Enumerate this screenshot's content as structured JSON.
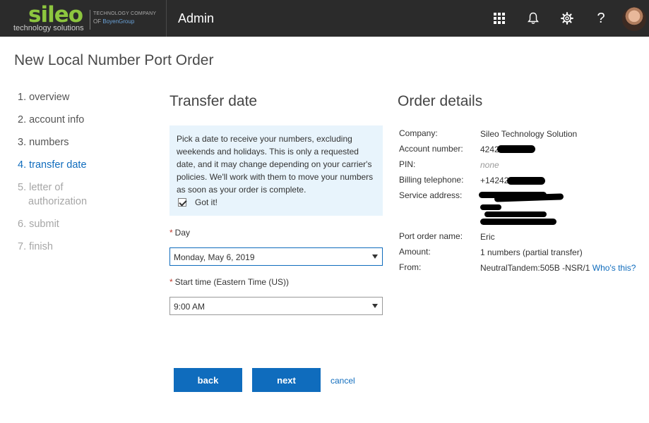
{
  "header": {
    "logo_word": "sileo",
    "logo_sub": "technology solutions",
    "logo_tag_line1": "TECHNOLOGY COMPANY",
    "logo_tag_of": "OF ",
    "logo_tag_brand": "BoyenGroup",
    "app_title": "Admin",
    "icons": [
      "app-launcher-icon",
      "bell-icon",
      "gear-icon",
      "help-icon"
    ],
    "help_glyph": "?"
  },
  "page": {
    "title": "New Local Number Port Order"
  },
  "steps": [
    {
      "label": "1. overview",
      "state": "done"
    },
    {
      "label": "2. account info",
      "state": "done"
    },
    {
      "label": "3. numbers",
      "state": "done"
    },
    {
      "label": "4. transfer date",
      "state": "active"
    },
    {
      "label_line1": "5. letter of",
      "label_line2": "authorization",
      "state": "disabled"
    },
    {
      "label": "6. submit",
      "state": "disabled"
    },
    {
      "label": "7. finish",
      "state": "disabled"
    }
  ],
  "transfer": {
    "title": "Transfer date",
    "info": "Pick a date to receive your numbers, excluding weekends and holidays. This is only a requested date, and it may change depending on your carrier's policies. We'll work with them to move your numbers as soon as your order is complete.",
    "gotit_label": "Got it!",
    "gotit_checked": true,
    "required_mark": "*",
    "day_label": "Day",
    "day_value": "Monday, May 6, 2019",
    "start_label": "Start time (Eastern Time (US))",
    "start_value": "9:00 AM"
  },
  "order": {
    "title": "Order details",
    "company_label": "Company:",
    "company_value": "Sileo Technology Solution",
    "account_label": "Account number:",
    "account_value": "4242",
    "pin_label": "PIN:",
    "pin_value": "none",
    "billing_label": "Billing telephone:",
    "billing_value": "+14242",
    "address_label": "Service address:",
    "port_name_label": "Port order name:",
    "port_name_value": "Eric",
    "amount_label": "Amount:",
    "amount_value": "1 numbers (partial transfer)",
    "from_label": "From:",
    "from_value": "NeutralTandem:505B -NSR/1",
    "whos_this": "Who's this?"
  },
  "actions": {
    "back": "back",
    "next": "next",
    "cancel": "cancel"
  },
  "colors": {
    "accent": "#0f6cbd",
    "logo_green": "#8dc63f",
    "topbar": "#2b2b2b",
    "info_bg": "#e8f4fc"
  }
}
